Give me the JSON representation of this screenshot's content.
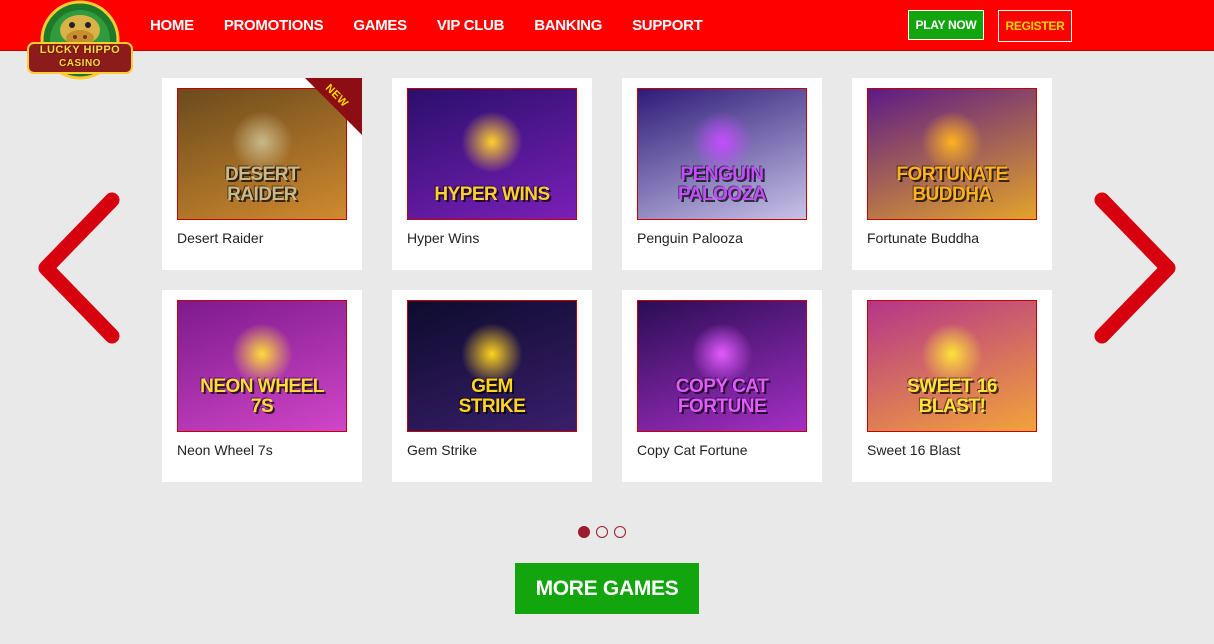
{
  "brand": {
    "name_line1": "LUCKY HIPPO",
    "name_line2": "CASINO"
  },
  "nav": {
    "items": [
      {
        "label": "HOME"
      },
      {
        "label": "PROMOTIONS"
      },
      {
        "label": "GAMES"
      },
      {
        "label": "VIP CLUB"
      },
      {
        "label": "BANKING"
      },
      {
        "label": "SUPPORT"
      }
    ]
  },
  "header": {
    "play_now_label": "PLAY NOW",
    "register_label": "REGISTER"
  },
  "games": [
    {
      "name": "Desert Raider",
      "thumb_line1": "DESERT",
      "thumb_line2": "RAIDER",
      "badge": "NEW",
      "bg_from": "#6b4a1c",
      "bg_to": "#d08a2f",
      "text_color": "#c9b98a"
    },
    {
      "name": "Hyper Wins",
      "thumb_line1": "HYPER WINS",
      "thumb_line2": "",
      "bg_from": "#2a0f6b",
      "bg_to": "#7a1fb8",
      "text_color": "#ffcf2e"
    },
    {
      "name": "Penguin Palooza",
      "thumb_line1": "PENGUIN",
      "thumb_line2": "PALOOZA",
      "bg_from": "#2e1b78",
      "bg_to": "#c7c2e8",
      "text_color": "#c44cff"
    },
    {
      "name": "Fortunate Buddha",
      "thumb_line1": "FORTUNATE",
      "thumb_line2": "BUDDHA",
      "bg_from": "#5d1a86",
      "bg_to": "#e3a32a",
      "text_color": "#ffb21f"
    },
    {
      "name": "Neon Wheel 7s",
      "thumb_line1": "NEON WHEEL",
      "thumb_line2": "7s",
      "bg_from": "#7d1a8c",
      "bg_to": "#d046c8",
      "text_color": "#ffdb3a"
    },
    {
      "name": "Gem Strike",
      "thumb_line1": "GEM",
      "thumb_line2": "STRIKE",
      "bg_from": "#0d0b2e",
      "bg_to": "#3a1f6b",
      "text_color": "#ffd41f"
    },
    {
      "name": "Copy Cat Fortune",
      "thumb_line1": "COPY CAT",
      "thumb_line2": "FORTUNE",
      "bg_from": "#2a0d55",
      "bg_to": "#a52fc4",
      "text_color": "#e25bff"
    },
    {
      "name": "Sweet 16 Blast",
      "thumb_line1": "SWEET 16",
      "thumb_line2": "BLAST!",
      "bg_from": "#b5358a",
      "bg_to": "#f2a33a",
      "text_color": "#ffe33a"
    }
  ],
  "pager": {
    "pages": 3,
    "active_index": 0
  },
  "cta": {
    "more_games_label": "MORE GAMES"
  },
  "colors": {
    "header_red": "#ff0000",
    "arrow_red": "#d7000f",
    "cta_green": "#12a50e",
    "register_yellow": "#ffd800"
  }
}
